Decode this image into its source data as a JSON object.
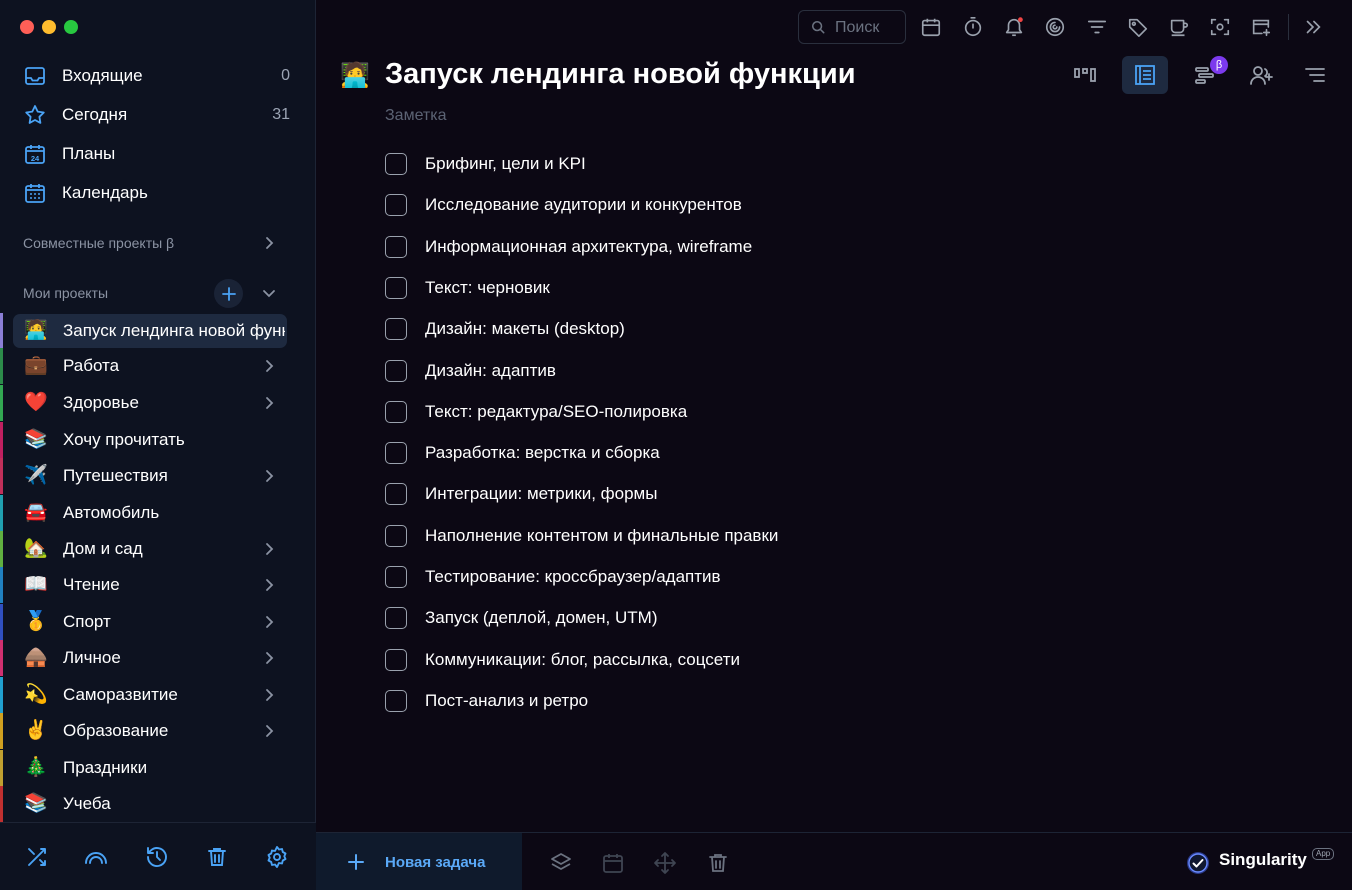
{
  "sidebar": {
    "nav": [
      {
        "label": "Входящие",
        "count": "0",
        "icon": "inbox-icon"
      },
      {
        "label": "Сегодня",
        "count": "31",
        "icon": "star-icon"
      },
      {
        "label": "Планы",
        "count": "",
        "icon": "plans-calendar-icon",
        "day": "24"
      },
      {
        "label": "Календарь",
        "count": "",
        "icon": "calendar-icon"
      }
    ],
    "shared_label": "Совместные проекты β",
    "my_label": "Мои проекты",
    "projects": [
      {
        "emoji": "🧑‍💻",
        "name": "Запуск лендинга новой функции",
        "color": "#8b7fd6",
        "chevron": false,
        "active": true
      },
      {
        "emoji": "💼",
        "name": "Работа",
        "color": "#2c8c4a",
        "chevron": true
      },
      {
        "emoji": "❤️",
        "name": "Здоровье",
        "color": "#32a852",
        "chevron": true
      },
      {
        "emoji": "📚",
        "name": "Хочу прочитать",
        "color": "#c02060",
        "chevron": false
      },
      {
        "emoji": "✈️",
        "name": "Путешествия",
        "color": "#c0305a",
        "chevron": true
      },
      {
        "emoji": "🚘",
        "name": "Автомобиль",
        "color": "#20a0b0",
        "chevron": false
      },
      {
        "emoji": "🏡",
        "name": "Дом и сад",
        "color": "#60b040",
        "chevron": true
      },
      {
        "emoji": "📖",
        "name": "Чтение",
        "color": "#2080c0",
        "chevron": true
      },
      {
        "emoji": "🥇",
        "name": "Спорт",
        "color": "#3050c0",
        "chevron": true
      },
      {
        "emoji": "🛖",
        "name": "Личное",
        "color": "#d03070",
        "chevron": true
      },
      {
        "emoji": "💫",
        "name": "Саморазвитие",
        "color": "#20a0d0",
        "chevron": true
      },
      {
        "emoji": "✌️",
        "name": "Образование",
        "color": "#d0a020",
        "chevron": true
      },
      {
        "emoji": "🎄",
        "name": "Праздники",
        "color": "#c0a030",
        "chevron": false
      },
      {
        "emoji": "📚",
        "name": "Учеба",
        "color": "#c03030",
        "chevron": false
      }
    ],
    "bottom_icons": [
      "shuffle-icon",
      "rainbow-icon",
      "history-icon",
      "trash-icon",
      "settings-icon"
    ]
  },
  "topbar": {
    "search_placeholder": "Поиск",
    "icons": [
      "calendar-icon",
      "timer-icon",
      "bell-icon",
      "focus-icon",
      "filter-icon",
      "tag-icon",
      "coffee-icon",
      "screenshot-icon",
      "add-window-icon",
      "expand-icon"
    ]
  },
  "main": {
    "title_emoji": "🧑‍💻",
    "title": "Запуск лендинга новой функции",
    "note_placeholder": "Заметка",
    "view_icons": [
      "kanban-view-icon",
      "list-view-icon",
      "gantt-view-icon",
      "share-user-icon",
      "sort-icon"
    ],
    "beta": "β",
    "tasks": [
      "Брифинг, цели и KPI",
      "Исследование аудитории и конкурентов",
      "Информационная архитектура, wireframe",
      "Текст: черновик",
      "Дизайн: макеты (desktop)",
      "Дизайн: адаптив",
      "Текст: редактура/SEO-полировка",
      "Разработка: верстка и сборка",
      "Интеграции: метрики, формы",
      "Наполнение контентом и финальные правки",
      "Тестирование: кроссбраузер/адаптив",
      "Запуск (деплой, домен, UTM)",
      "Коммуникации: блог, рассылка, соцсети",
      "Пост-анализ и ретро"
    ]
  },
  "bottombar": {
    "new_task": "Новая задача",
    "icons": [
      "layers-icon",
      "calendar-icon",
      "move-icon",
      "trash-icon"
    ],
    "brand": "Singularity",
    "brand_tag": "App"
  },
  "colors": {
    "accent": "#5aa9f7",
    "sidebar_bg": "#0d1220",
    "main_bg": "#0c0814",
    "selection": "#1e2a40"
  }
}
